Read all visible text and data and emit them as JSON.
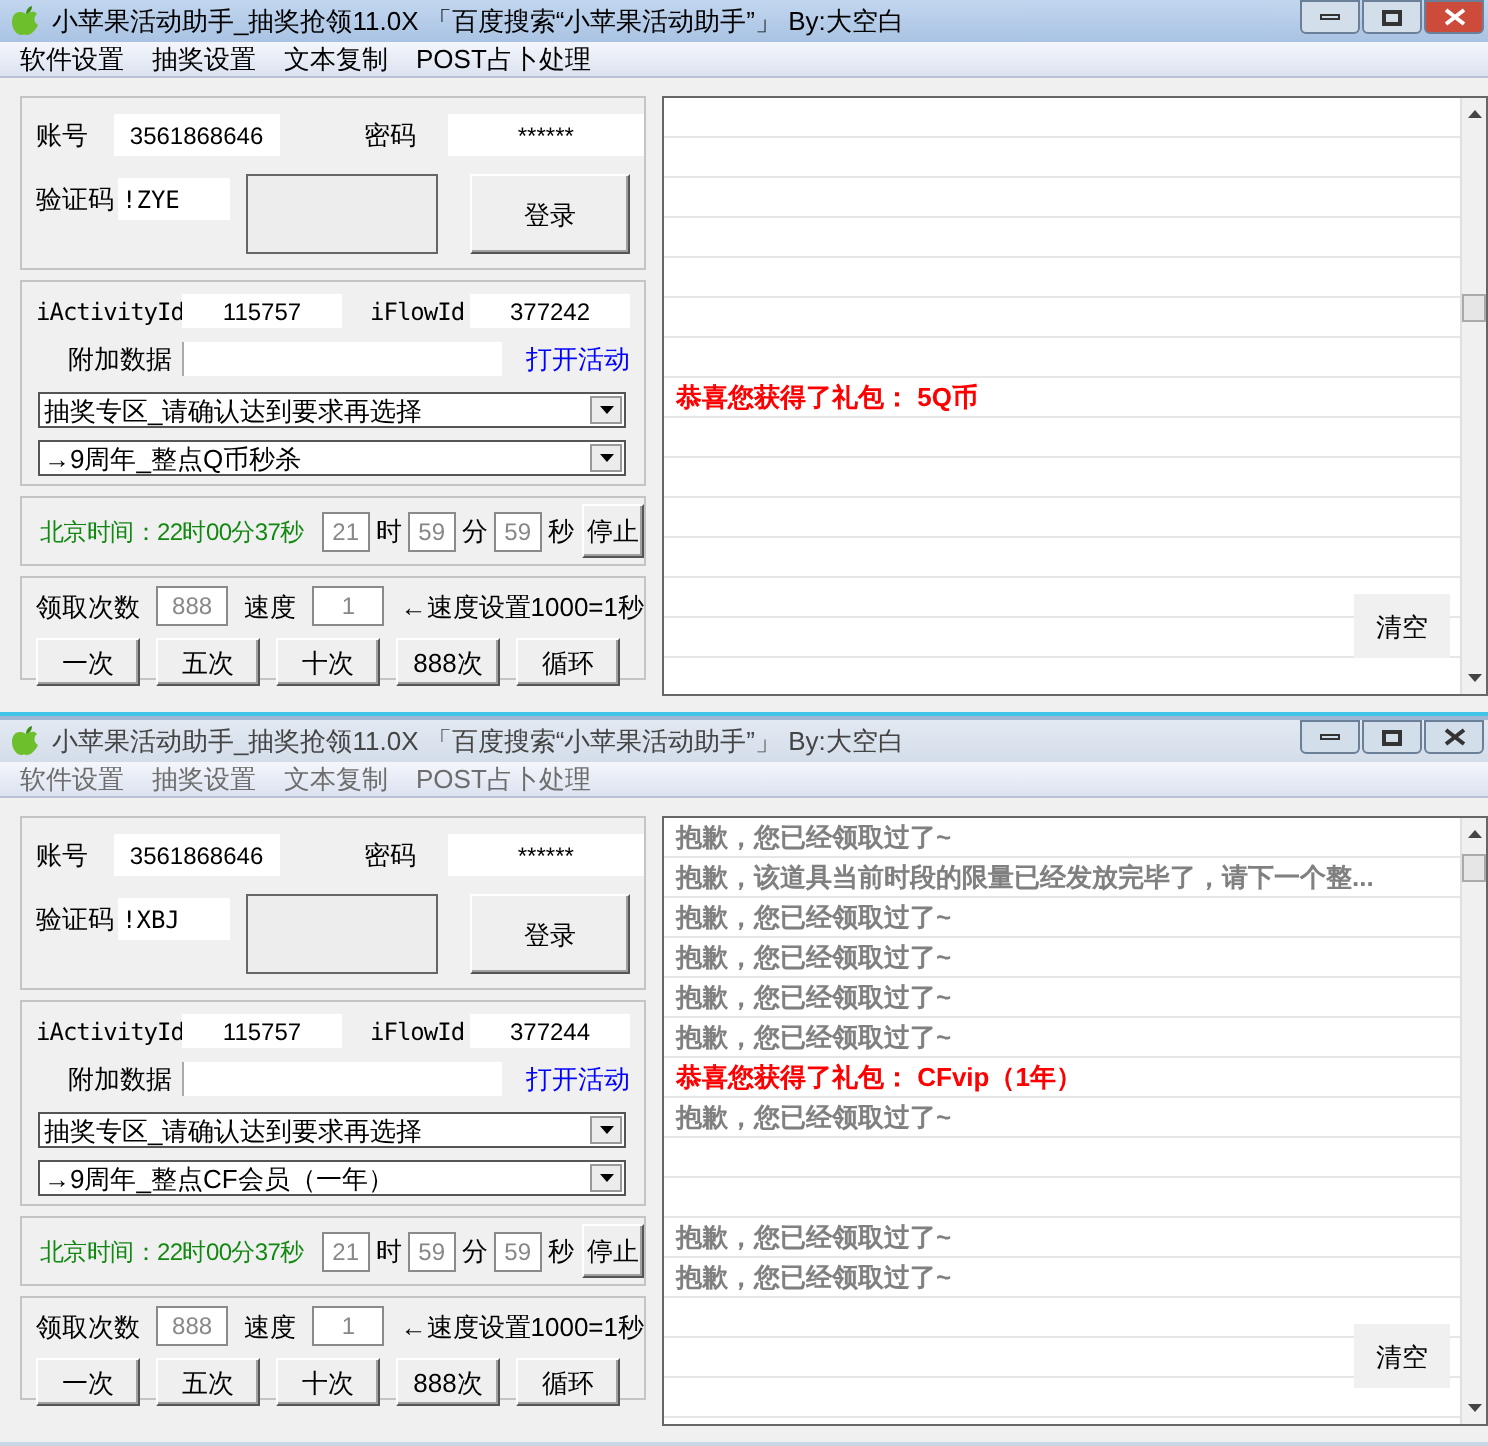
{
  "windows": [
    {
      "active": true,
      "title": "小苹果活动助手_抽奖抢领11.0X 「百度搜索“小苹果活动助手”」 By:大空白",
      "menu": [
        "软件设置",
        "抽奖设置",
        "文本复制",
        "POST占卜处理"
      ],
      "account_label": "账号",
      "account": "3561868646",
      "password_label": "密码",
      "password": "******",
      "captcha_label": "验证码",
      "captcha": "!ZYE",
      "login": "登录",
      "activity_label": "iActivityId",
      "activity_id": "115757",
      "flow_label": "iFlowId",
      "flow_id": "377242",
      "extra_label": "附加数据",
      "open_link": "打开活动",
      "dropdowns": [
        "抽奖专区_请确认达到要求再选择",
        "→9周年_整点Q币秒杀"
      ],
      "clock": "北京时间：22时00分37秒",
      "hour": "21",
      "hour_unit": "时",
      "minute": "59",
      "minute_unit": "分",
      "second": "59",
      "second_unit": "秒",
      "stop": "停止",
      "count_label": "领取次数",
      "count": "888",
      "speed_label": "速度",
      "speed": "1",
      "speed_hint": "←速度设置1000=1秒",
      "buttons": [
        "一次",
        "五次",
        "十次",
        "888次",
        "循环"
      ],
      "log": [
        {
          "kind": "blank"
        },
        {
          "kind": "blank"
        },
        {
          "kind": "blank"
        },
        {
          "kind": "blank"
        },
        {
          "kind": "blank"
        },
        {
          "kind": "blank"
        },
        {
          "kind": "blank"
        },
        {
          "kind": "prize",
          "text": "恭喜您获得了礼包： 5Q币"
        },
        {
          "kind": "blank"
        },
        {
          "kind": "blank"
        },
        {
          "kind": "blank"
        },
        {
          "kind": "blank"
        },
        {
          "kind": "blank"
        },
        {
          "kind": "blank"
        },
        {
          "kind": "blank"
        }
      ],
      "clear": "清空"
    },
    {
      "active": false,
      "title": "小苹果活动助手_抽奖抢领11.0X 「百度搜索“小苹果活动助手”」 By:大空白",
      "menu": [
        "软件设置",
        "抽奖设置",
        "文本复制",
        "POST占卜处理"
      ],
      "account_label": "账号",
      "account": "3561868646",
      "password_label": "密码",
      "password": "******",
      "captcha_label": "验证码",
      "captcha": "!XBJ",
      "login": "登录",
      "activity_label": "iActivityId",
      "activity_id": "115757",
      "flow_label": "iFlowId",
      "flow_id": "377244",
      "extra_label": "附加数据",
      "open_link": "打开活动",
      "dropdowns": [
        "抽奖专区_请确认达到要求再选择",
        "→9周年_整点CF会员（一年）"
      ],
      "clock": "北京时间：22时00分37秒",
      "hour": "21",
      "hour_unit": "时",
      "minute": "59",
      "minute_unit": "分",
      "second": "59",
      "second_unit": "秒",
      "stop": "停止",
      "count_label": "领取次数",
      "count": "888",
      "speed_label": "速度",
      "speed": "1",
      "speed_hint": "←速度设置1000=1秒",
      "buttons": [
        "一次",
        "五次",
        "十次",
        "888次",
        "循环"
      ],
      "log": [
        {
          "kind": "notice",
          "text": "抱歉，您已经领取过了~"
        },
        {
          "kind": "notice",
          "text": "抱歉，该道具当前时段的限量已经发放完毕了，请下一个整..."
        },
        {
          "kind": "notice",
          "text": "抱歉，您已经领取过了~"
        },
        {
          "kind": "notice",
          "text": "抱歉，您已经领取过了~"
        },
        {
          "kind": "notice",
          "text": "抱歉，您已经领取过了~"
        },
        {
          "kind": "notice",
          "text": "抱歉，您已经领取过了~"
        },
        {
          "kind": "prize",
          "text": "恭喜您获得了礼包： CFvip（1年）"
        },
        {
          "kind": "notice",
          "text": "抱歉，您已经领取过了~"
        },
        {
          "kind": "blank"
        },
        {
          "kind": "blank"
        },
        {
          "kind": "notice",
          "text": "抱歉，您已经领取过了~"
        },
        {
          "kind": "notice",
          "text": "抱歉，您已经领取过了~"
        },
        {
          "kind": "blank"
        },
        {
          "kind": "blank"
        },
        {
          "kind": "blank"
        }
      ],
      "clear": "清空"
    }
  ]
}
